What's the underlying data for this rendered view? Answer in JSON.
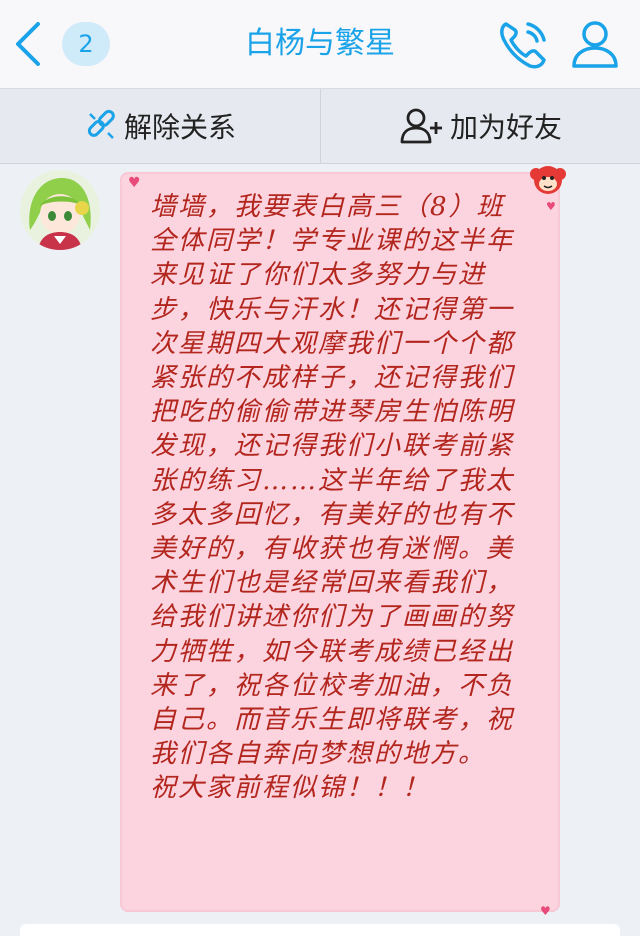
{
  "navbar": {
    "unread_count": "2",
    "title": "白杨与繁星"
  },
  "action_bar": {
    "remove_relation_label": "解除关系",
    "add_friend_label": "加为好友"
  },
  "message": {
    "text": "墙墙，我要表白高三（8）班全体同学！学专业课的这半年来见证了你们太多努力与进步，快乐与汗水！还记得第一次星期四大观摩我们一个个都紧张的不成样子，还记得我们把吃的偷偷带进琴房生怕陈明发现，还记得我们小联考前紧张的练习……这半年给了我太多太多回忆，有美好的也有不美好的，有收获也有迷惘。美术生们也是经常回来看我们，给我们讲述你们为了画画的努力牺牲，如今联考成绩已经出来了，祝各位校考加油，不负自己。而音乐生即将联考，祝我们各自奔向梦想的地方。\n祝大家前程似锦！！！"
  },
  "colors": {
    "accent": "#1aa3e8",
    "bubble_bg": "#fbd4df",
    "message_text": "#b3261e"
  },
  "icons": {
    "back": "chevron-left-icon",
    "phone": "phone-icon",
    "profile": "person-icon",
    "unlink": "unlink-icon",
    "add_friend": "add-person-icon"
  }
}
